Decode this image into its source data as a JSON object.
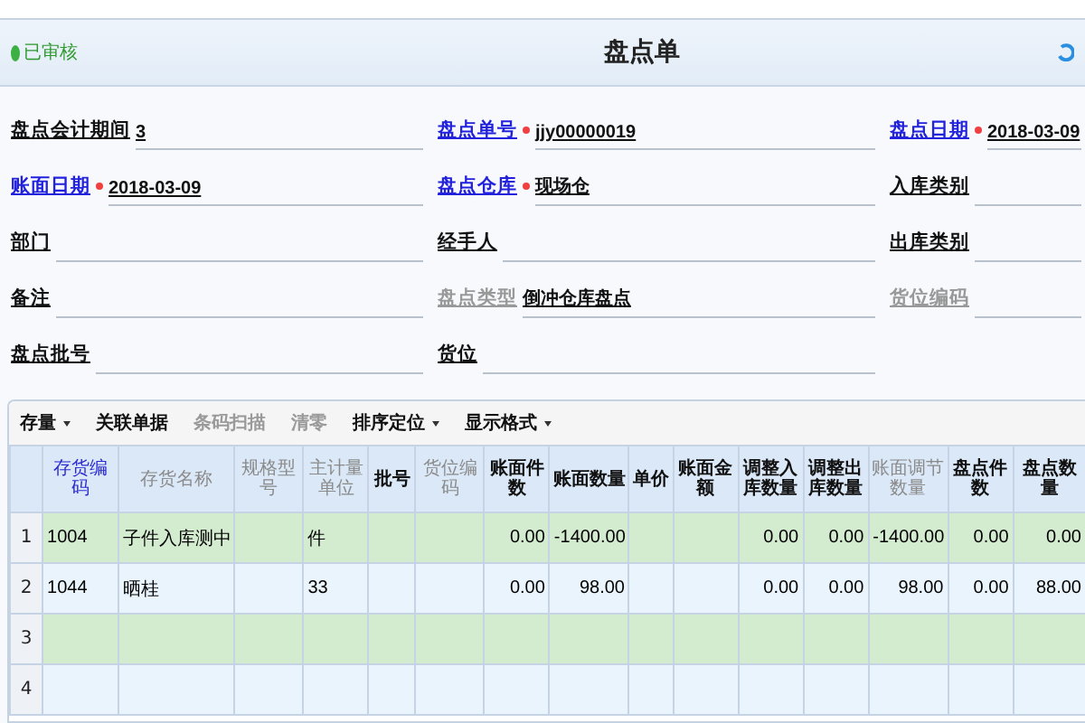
{
  "header": {
    "status": "已审核",
    "title": "盘点单"
  },
  "form": [
    {
      "label": "盘点会计期间",
      "kind": "plain",
      "required": false,
      "value": "3"
    },
    {
      "label": "盘点单号",
      "kind": "link",
      "required": true,
      "value": "jjy00000019"
    },
    {
      "label": "盘点日期",
      "kind": "link",
      "required": true,
      "value": "2018-03-09"
    },
    {
      "label": "账面日期",
      "kind": "link",
      "required": true,
      "value": "2018-03-09"
    },
    {
      "label": "盘点仓库",
      "kind": "link",
      "required": true,
      "value": "现场仓"
    },
    {
      "label": "入库类别",
      "kind": "plain",
      "required": false
    },
    {
      "label": "部门",
      "kind": "plain",
      "required": false
    },
    {
      "label": "经手人",
      "kind": "plain",
      "required": false
    },
    {
      "label": "出库类别",
      "kind": "plain",
      "required": false
    },
    {
      "label": "备注",
      "kind": "plain",
      "required": false
    },
    {
      "label": "盘点类型",
      "kind": "disabled",
      "required": false,
      "value": "倒冲仓库盘点"
    },
    {
      "label": "货位编码",
      "kind": "disabled",
      "required": false
    },
    {
      "label": "盘点批号",
      "kind": "plain",
      "required": false
    },
    {
      "label": "货位",
      "kind": "plain",
      "required": false
    }
  ],
  "toolbar": [
    {
      "label": "存量",
      "dropdown": true,
      "disabled": false
    },
    {
      "label": "关联单据",
      "dropdown": false,
      "disabled": false
    },
    {
      "label": "条码扫描",
      "dropdown": false,
      "disabled": true
    },
    {
      "label": "清零",
      "dropdown": false,
      "disabled": true
    },
    {
      "label": "排序定位",
      "dropdown": true,
      "disabled": false
    },
    {
      "label": "显示格式",
      "dropdown": true,
      "disabled": false
    }
  ],
  "table": {
    "columns": [
      {
        "label": "存货编码",
        "kind": "link"
      },
      {
        "label": "存货名称",
        "kind": "disabled"
      },
      {
        "label": "规格型号",
        "kind": "disabled"
      },
      {
        "label": "主计量单位",
        "kind": "disabled"
      },
      {
        "label": "批号",
        "kind": "plain"
      },
      {
        "label": "货位编码",
        "kind": "disabled"
      },
      {
        "label": "账面件数",
        "kind": "plain"
      },
      {
        "label": "账面数量",
        "kind": "plain"
      },
      {
        "label": "单价",
        "kind": "plain"
      },
      {
        "label": "账面金额",
        "kind": "plain"
      },
      {
        "label": "调整入库数量",
        "kind": "plain"
      },
      {
        "label": "调整出库数量",
        "kind": "plain"
      },
      {
        "label": "账面调节数量",
        "kind": "disabled"
      },
      {
        "label": "盘点件数",
        "kind": "plain"
      },
      {
        "label": "盘点数量",
        "kind": "plain"
      }
    ],
    "rows": [
      {
        "number": "1",
        "cells": [
          "1004",
          "子件入库测中",
          null,
          "件",
          null,
          null,
          "0.00",
          "-1400.00",
          null,
          null,
          "0.00",
          "0.00",
          "-1400.00",
          "0.00",
          "0.00"
        ]
      },
      {
        "number": "2",
        "cells": [
          "1044",
          "晒桂",
          null,
          "33",
          null,
          null,
          "0.00",
          "98.00",
          null,
          null,
          "0.00",
          "0.00",
          "98.00",
          "0.00",
          "88.00"
        ]
      },
      {
        "number": "3"
      },
      {
        "number": "4"
      }
    ]
  }
}
